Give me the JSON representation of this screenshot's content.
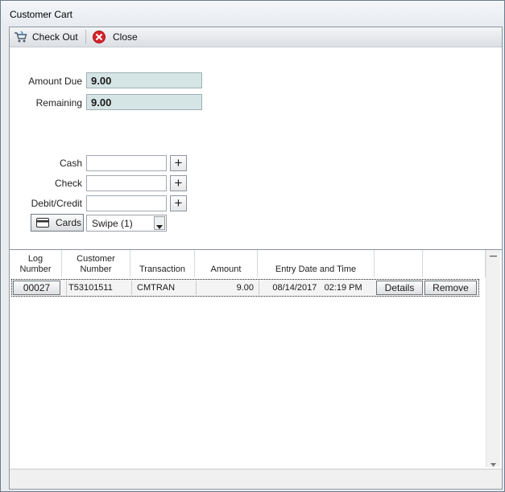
{
  "window": {
    "title": "Customer Cart"
  },
  "toolbar": {
    "checkout_label": "Check Out",
    "close_label": "Close"
  },
  "summary": {
    "amount_due_label": "Amount Due",
    "amount_due_value": "9.00",
    "remaining_label": "Remaining",
    "remaining_value": "9.00"
  },
  "payment": {
    "cash_label": "Cash",
    "cash_value": "",
    "check_label": "Check",
    "check_value": "",
    "debit_label": "Debit/Credit",
    "debit_value": "",
    "plus_glyph": "+",
    "cards_label": "Cards",
    "swipe_selected": "Swipe (1)"
  },
  "grid": {
    "headers": [
      [
        "Log",
        "Number"
      ],
      [
        "Customer",
        "Number"
      ],
      [
        "Transaction"
      ],
      [
        "Amount"
      ],
      [
        "Entry Date and Time"
      ]
    ],
    "rows": [
      {
        "log_number": "00027",
        "customer_number": "T53101511",
        "transaction": "CMTRAN",
        "amount": "9.00",
        "entry_datetime": "08/14/2017   02:19 PM",
        "details_label": "Details",
        "remove_label": "Remove"
      }
    ]
  },
  "colors": {
    "readonly_field_bg": "#d5e4e4",
    "close_icon_red": "#d8232a"
  }
}
